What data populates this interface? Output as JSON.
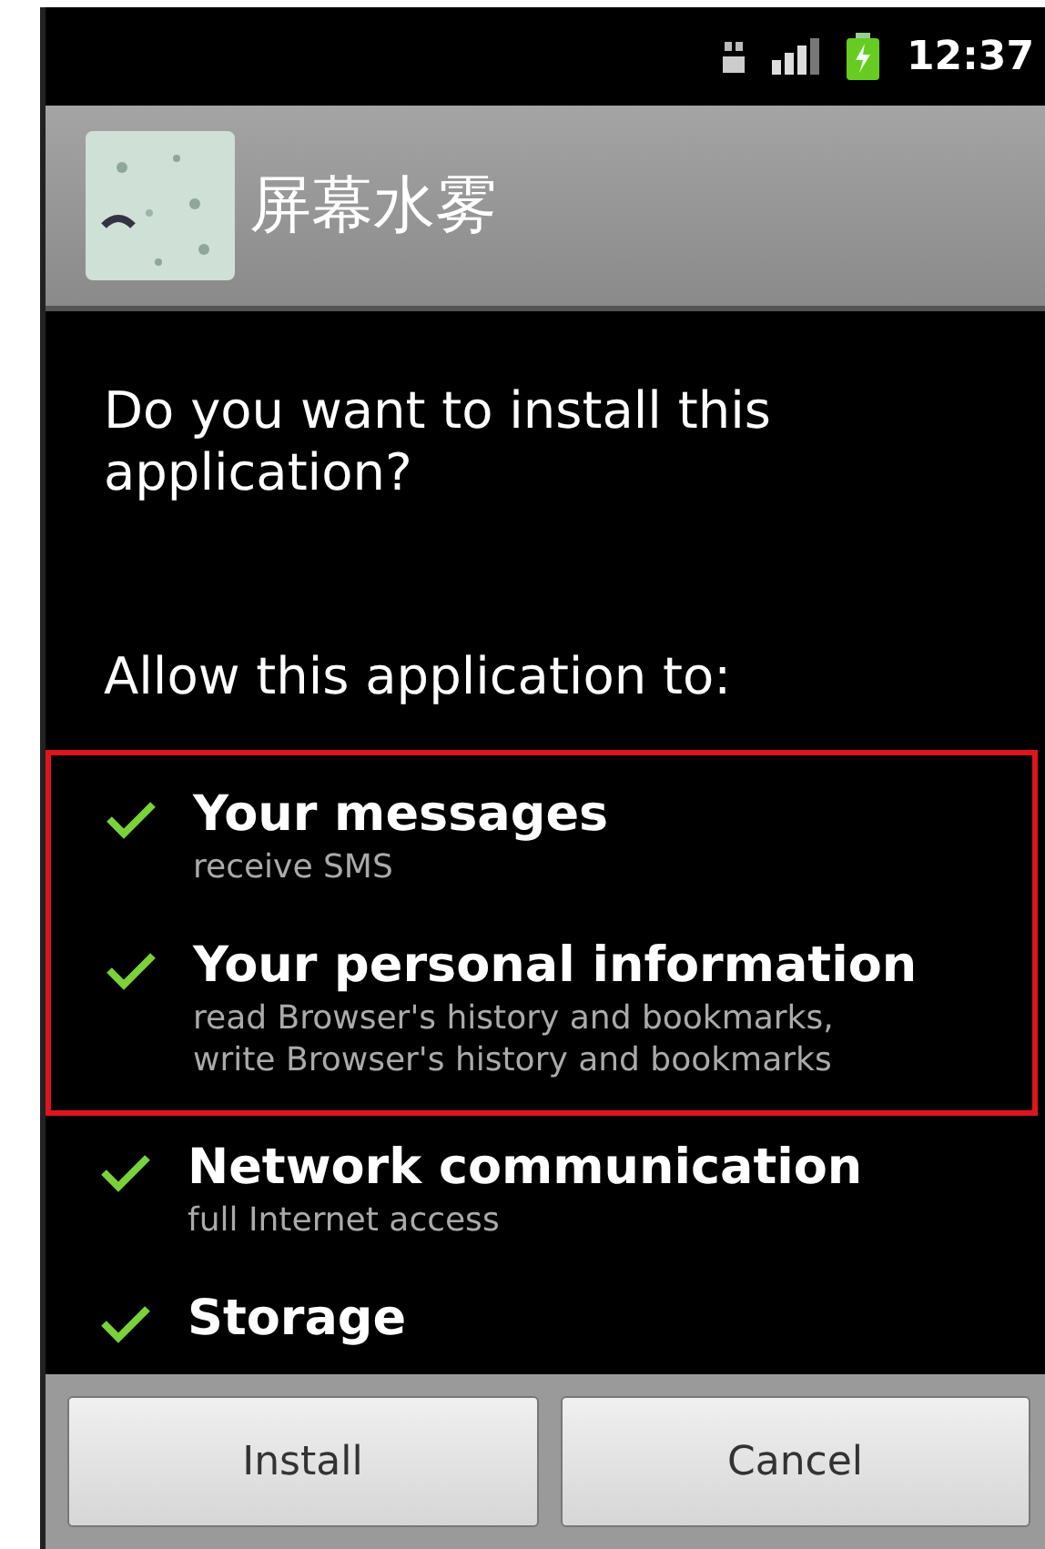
{
  "status_bar": {
    "time": "12:37"
  },
  "app": {
    "name": "屏幕水雾"
  },
  "question": "Do you want to install this application?",
  "permissions_heading": "Allow this application to:",
  "permissions": [
    {
      "title": "Your messages",
      "details": [
        "receive SMS"
      ],
      "highlighted": true
    },
    {
      "title": "Your personal information",
      "details": [
        "read Browser's history and bookmarks,",
        "write Browser's history and bookmarks"
      ],
      "highlighted": true
    },
    {
      "title": "Network communication",
      "details": [
        "full Internet access"
      ],
      "highlighted": false
    },
    {
      "title": "Storage",
      "highlighted": false
    }
  ],
  "buttons": [
    "Install",
    "Cancel"
  ]
}
